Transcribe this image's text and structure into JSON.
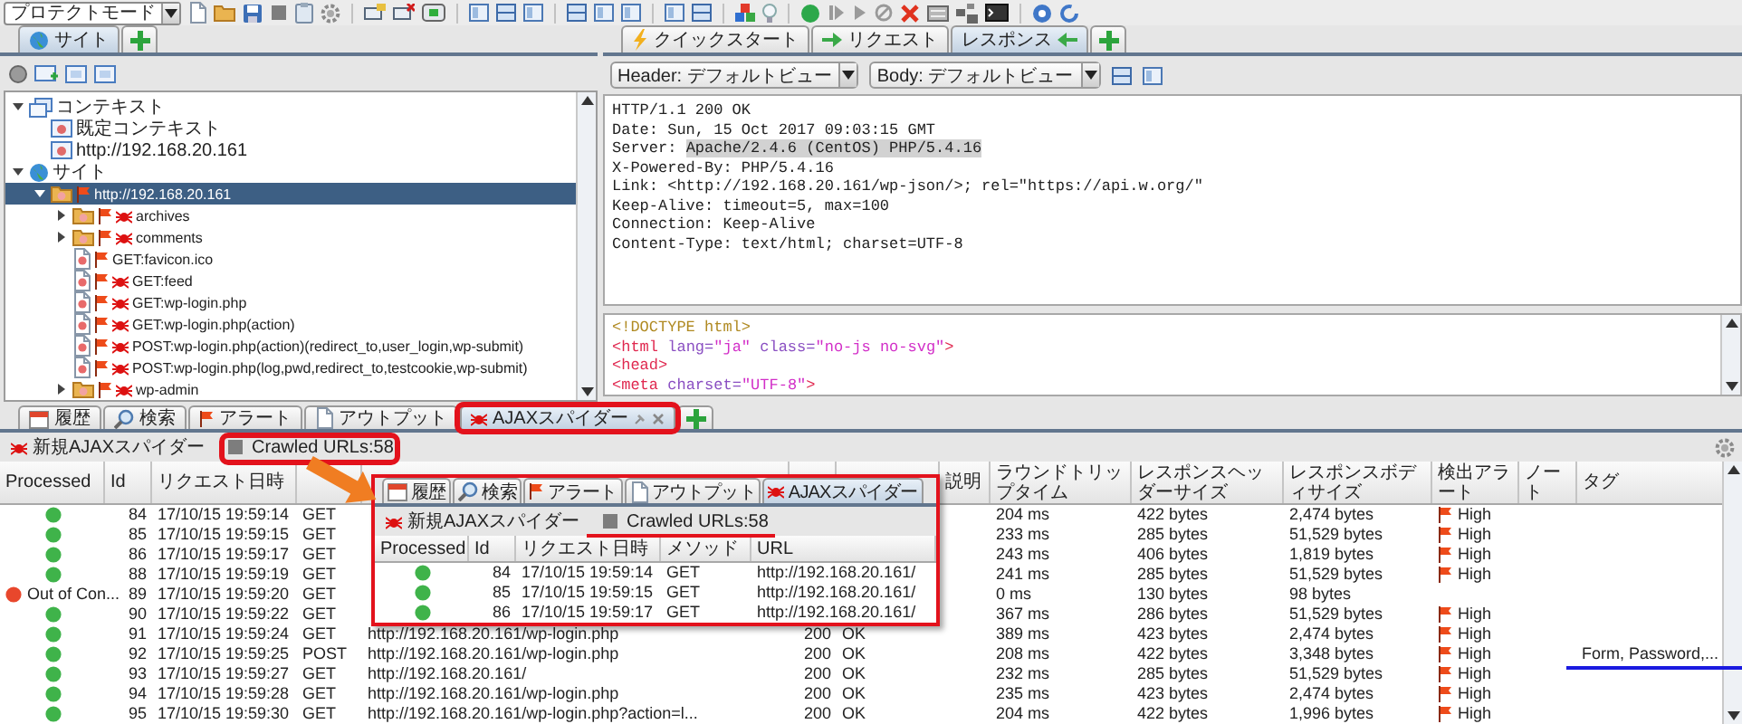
{
  "toolbar": {
    "mode": "プロテクトモード"
  },
  "sites_panel": {
    "tabs": [
      {
        "label": "サイト",
        "selected": true
      }
    ],
    "tree": [
      {
        "label": "コンテキスト",
        "kind": "context-group",
        "expanded": true,
        "selected": false,
        "children": [
          {
            "label": "既定コンテキスト",
            "kind": "context",
            "selected": false
          },
          {
            "label": "http://192.168.20.161",
            "kind": "context",
            "selected": false
          }
        ]
      },
      {
        "label": "サイト",
        "kind": "sites",
        "expanded": true,
        "selected": false,
        "children": [
          {
            "label": "http://192.168.20.161",
            "kind": "folder",
            "expanded": true,
            "selected": true,
            "alert": true,
            "spider": false,
            "children": [
              {
                "label": "archives",
                "kind": "folder",
                "expanded": false,
                "selected": false,
                "alert": true,
                "spider": true
              },
              {
                "label": "comments",
                "kind": "folder",
                "expanded": false,
                "selected": false,
                "alert": true,
                "spider": true
              },
              {
                "label": "GET:favicon.ico",
                "kind": "page",
                "selected": false,
                "alert": true,
                "spider": false
              },
              {
                "label": "GET:feed",
                "kind": "page",
                "selected": false,
                "alert": true,
                "spider": true
              },
              {
                "label": "GET:wp-login.php",
                "kind": "page",
                "selected": false,
                "alert": true,
                "spider": true
              },
              {
                "label": "GET:wp-login.php(action)",
                "kind": "page",
                "selected": false,
                "alert": true,
                "spider": true
              },
              {
                "label": "POST:wp-login.php(action)(redirect_to,user_login,wp-submit)",
                "kind": "page",
                "selected": false,
                "alert": true,
                "spider": true
              },
              {
                "label": "POST:wp-login.php(log,pwd,redirect_to,testcookie,wp-submit)",
                "kind": "page",
                "selected": false,
                "alert": true,
                "spider": true
              },
              {
                "label": "wp-admin",
                "kind": "folder",
                "expanded": false,
                "selected": false,
                "alert": true,
                "spider": true
              }
            ]
          }
        ]
      }
    ]
  },
  "message_panel": {
    "tabs": [
      {
        "label": "クイックスタート",
        "selected": false
      },
      {
        "label": "リクエスト",
        "selected": false
      },
      {
        "label": "レスポンス",
        "selected": true
      }
    ],
    "header_view": "Header: デフォルトビュー",
    "body_view": "Body: デフォルトビュー",
    "header_lines": [
      {
        "text": "HTTP/1.1 200 OK"
      },
      {
        "text": "Date: Sun, 15 Oct 2017 09:03:15 GMT"
      },
      {
        "text": "Server: ",
        "selection": "Apache/2.4.6 (CentOS) PHP/5.4.16"
      },
      {
        "text": "X-Powered-By: PHP/5.4.16"
      },
      {
        "text": "Link: <http://192.168.20.161/wp-json/>; rel=\"https://api.w.org/\""
      },
      {
        "text": "Keep-Alive: timeout=5, max=100"
      },
      {
        "text": "Connection: Keep-Alive"
      },
      {
        "text": "Content-Type: text/html; charset=UTF-8"
      }
    ],
    "body_lines": [
      [
        {
          "kind": "doctype",
          "text": "<!DOCTYPE html>"
        }
      ],
      [
        {
          "kind": "tag",
          "text": "<html"
        },
        {
          "kind": "attr",
          "text": " lang="
        },
        {
          "kind": "value",
          "text": "\"ja\""
        },
        {
          "kind": "attr",
          "text": " class="
        },
        {
          "kind": "value",
          "text": "\"no-js no-svg\""
        },
        {
          "kind": "tag",
          "text": ">"
        }
      ],
      [
        {
          "kind": "tag",
          "text": "<head>"
        }
      ],
      [
        {
          "kind": "tag",
          "text": "<meta"
        },
        {
          "kind": "attr",
          "text": " charset="
        },
        {
          "kind": "value",
          "text": "\"UTF-8\""
        },
        {
          "kind": "tag",
          "text": ">"
        }
      ]
    ]
  },
  "bottom_panel": {
    "tabs": [
      {
        "label": "履歴",
        "selected": false
      },
      {
        "label": "検索",
        "selected": false
      },
      {
        "label": "アラート",
        "selected": false
      },
      {
        "label": "アウトプット",
        "selected": false
      },
      {
        "label": "AJAXスパイダー",
        "selected": true
      }
    ],
    "new_scan": "新規AJAXスパイダー",
    "crawled": "Crawled URLs:58",
    "table": {
      "columns": [
        "Processed",
        "Id",
        "リクエスト日時",
        null,
        null,
        null,
        null,
        "説明",
        "ラウンドトリップタイム",
        "レスポンスヘッダーサイズ",
        "レスポンスボディサイズ",
        "検出アラート",
        "ノート",
        "タグ"
      ],
      "rows": [
        {
          "processed": true,
          "id": "84",
          "time": "17/10/15 19:59:14",
          "method": "GET",
          "rtt": "204 ms",
          "header_size": "422 bytes",
          "body_size": "2,474 bytes",
          "alert": "High"
        },
        {
          "processed": true,
          "id": "85",
          "time": "17/10/15 19:59:15",
          "method": "GET",
          "rtt": "233 ms",
          "header_size": "285 bytes",
          "body_size": "51,529 bytes",
          "alert": "High"
        },
        {
          "processed": true,
          "id": "86",
          "time": "17/10/15 19:59:17",
          "method": "GET",
          "rtt": "243 ms",
          "header_size": "406 bytes",
          "body_size": "1,819 bytes",
          "alert": "High"
        },
        {
          "processed": true,
          "id": "88",
          "time": "17/10/15 19:59:19",
          "method": "GET",
          "rtt": "241 ms",
          "header_size": "285 bytes",
          "body_size": "51,529 bytes",
          "alert": "High"
        },
        {
          "processed": false,
          "processed_label": "Out of Con...",
          "id": "89",
          "time": "17/10/15 19:59:20",
          "method": "GET",
          "rtt": "0 ms",
          "header_size": "130 bytes",
          "body_size": "98 bytes"
        },
        {
          "processed": true,
          "id": "90",
          "time": "17/10/15 19:59:22",
          "method": "GET",
          "rtt": "367 ms",
          "header_size": "286 bytes",
          "body_size": "51,529 bytes",
          "alert": "High"
        },
        {
          "processed": true,
          "id": "91",
          "time": "17/10/15 19:59:24",
          "method": "GET",
          "url": "http://192.168.20.161/wp-login.php",
          "code": "200",
          "reason": "OK",
          "rtt": "389 ms",
          "header_size": "423 bytes",
          "body_size": "2,474 bytes",
          "alert": "High"
        },
        {
          "processed": true,
          "id": "92",
          "time": "17/10/15 19:59:25",
          "method": "POST",
          "url": "http://192.168.20.161/wp-login.php",
          "code": "200",
          "reason": "OK",
          "rtt": "208 ms",
          "header_size": "422 bytes",
          "body_size": "3,348 bytes",
          "alert": "High",
          "tag": "Form, Password,..."
        },
        {
          "processed": true,
          "id": "93",
          "time": "17/10/15 19:59:27",
          "method": "GET",
          "url": "http://192.168.20.161/",
          "code": "200",
          "reason": "OK",
          "rtt": "232 ms",
          "header_size": "285 bytes",
          "body_size": "51,529 bytes",
          "alert": "High"
        },
        {
          "processed": true,
          "id": "94",
          "time": "17/10/15 19:59:28",
          "method": "GET",
          "url": "http://192.168.20.161/wp-login.php",
          "code": "200",
          "reason": "OK",
          "rtt": "235 ms",
          "header_size": "423 bytes",
          "body_size": "2,474 bytes",
          "alert": "High"
        },
        {
          "processed": true,
          "id": "95",
          "time": "17/10/15 19:59:30",
          "method": "GET",
          "url": "http://192.168.20.161/wp-login.php?action=l...",
          "code": "200",
          "reason": "OK",
          "rtt": "204 ms",
          "header_size": "422 bytes",
          "body_size": "1,996 bytes",
          "alert": "High"
        }
      ]
    }
  },
  "callout": {
    "tabs": [
      {
        "label": "履歴",
        "selected": false
      },
      {
        "label": "検索",
        "selected": false
      },
      {
        "label": "アラート",
        "selected": false
      },
      {
        "label": "アウトプット",
        "selected": false
      },
      {
        "label": "AJAXスパイダー",
        "selected": true
      }
    ],
    "new_scan": "新規AJAXスパイダー",
    "crawled": "Crawled URLs:58",
    "table": {
      "columns": [
        "Processed",
        "Id",
        "リクエスト日時",
        "メソッド",
        "URL"
      ],
      "rows": [
        {
          "processed": true,
          "id": "84",
          "time": "17/10/15 19:59:14",
          "method": "GET",
          "url": "http://192.168.20.161/"
        },
        {
          "processed": true,
          "id": "85",
          "time": "17/10/15 19:59:15",
          "method": "GET",
          "url": "http://192.168.20.161/"
        },
        {
          "processed": true,
          "id": "86",
          "time": "17/10/15 19:59:17",
          "method": "GET",
          "url": "http://192.168.20.161/"
        }
      ]
    }
  }
}
